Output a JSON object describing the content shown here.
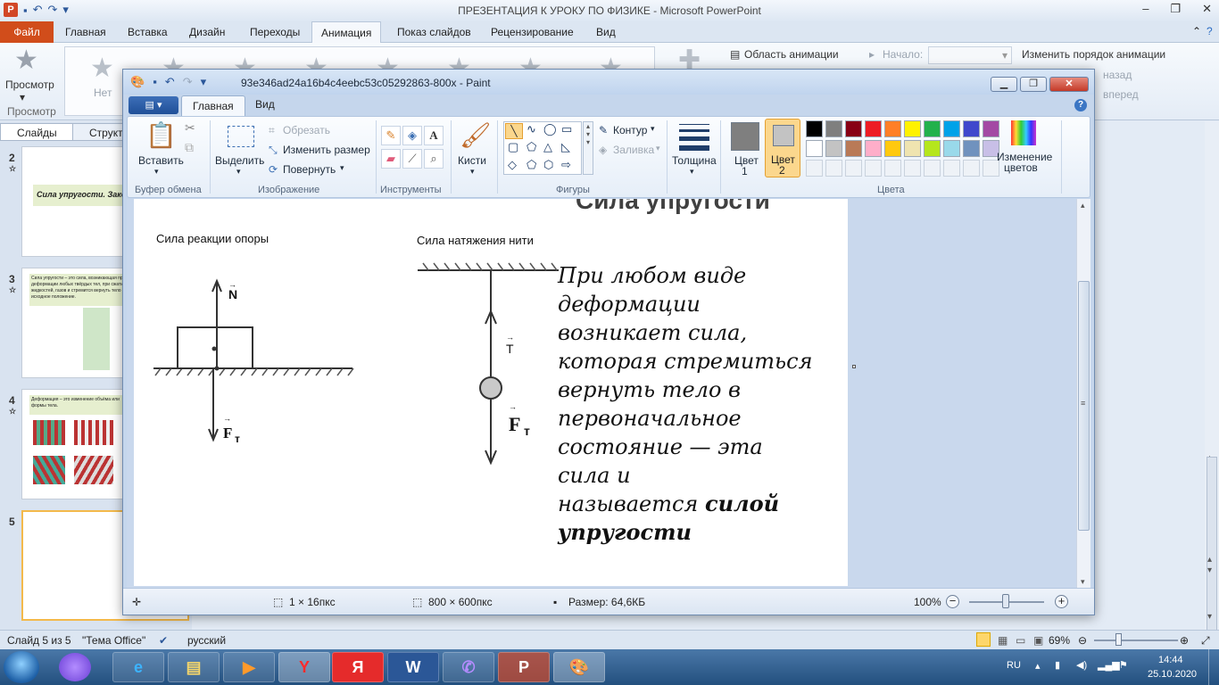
{
  "powerpoint": {
    "title": "ПРЕЗЕНТАЦИЯ К УРОКУ ПО ФИЗИКЕ  -  Microsoft PowerPoint",
    "tabs": [
      "Файл",
      "Главная",
      "Вставка",
      "Дизайн",
      "Переходы",
      "Анимация",
      "Показ слайдов",
      "Рецензирование",
      "Вид"
    ],
    "active_tab": "Анимация",
    "ribbon": {
      "preview": "Просмотр",
      "preview_group": "Просмотр",
      "none": "Нет",
      "animation_pane": "Область анимации",
      "start_label": "Начало:",
      "reorder": "Изменить порядок анимации",
      "move_back": "назад",
      "move_forward": "вперед"
    },
    "panel_tabs": [
      "Слайды",
      "Структура"
    ],
    "thumbnails": [
      {
        "num": "2",
        "text": "Сила упругости. Закон"
      },
      {
        "num": "3",
        "text": "Сила упругости – это сила, возникающая при деформации любых твёрдых тел, при сжатии жидкостей, газов и стремится вернуть тело в исходное положение."
      },
      {
        "num": "4",
        "text": "Деформация – это изменение объёма или формы тела."
      },
      {
        "num": "5",
        "text": ""
      }
    ],
    "status": {
      "slide": "Слайд 5 из 5",
      "theme": "\"Тема Office\"",
      "lang": "русский",
      "zoom": "69%"
    }
  },
  "paint": {
    "title": "93e346ad24a16b4c4eebc53c05292863-800x - Paint",
    "tabs": [
      "Главная",
      "Вид"
    ],
    "ribbon": {
      "paste": "Вставить",
      "clipboard_group": "Буфер обмена",
      "select": "Выделить",
      "crop": "Обрезать",
      "resize": "Изменить размер",
      "rotate": "Повернуть",
      "image_group": "Изображение",
      "tools_group": "Инструменты",
      "brushes": "Кисти",
      "outline": "Контур",
      "fill": "Заливка",
      "shapes_group": "Фигуры",
      "size": "Толщина",
      "color1_a": "Цвет",
      "color1_b": "1",
      "color2_a": "Цвет",
      "color2_b": "2",
      "colors_group": "Цвета",
      "edit_colors_a": "Изменение",
      "edit_colors_b": "цветов"
    },
    "palette": [
      "#000000",
      "#7f7f7f",
      "#880015",
      "#ed1c24",
      "#ff7f27",
      "#fff200",
      "#22b14c",
      "#00a2e8",
      "#3f48cc",
      "#a349a4",
      "#ffffff",
      "#c3c3c3",
      "#b97a57",
      "#ffaec9",
      "#ffc90e",
      "#efe4b0",
      "#b5e61d",
      "#99d9ea",
      "#7092be",
      "#c8bfe7"
    ],
    "color1": "#7f7f7f",
    "color2": "#c3c3c3",
    "status": {
      "selection": "1 × 16пкс",
      "image_size": "800 × 600пкс",
      "file_size": "Размер: 64,6КБ",
      "zoom": "100%"
    },
    "slide": {
      "title": "Сила упругости",
      "caption_support": "Сила реакции опоры",
      "caption_tension": "Сила натяжения нити",
      "label_n": "N",
      "label_ft": "F",
      "label_ft_sub": "т",
      "label_t": "T",
      "text_lines": [
        "При любом виде",
        "деформации",
        "возникает сила,",
        "которая стремиться",
        "вернуть тело в",
        "первоначальное",
        "состояние — эта",
        "сила и"
      ],
      "text_last": "называется ",
      "text_bold_1": "силой",
      "text_bold_2": "упругости"
    }
  },
  "taskbar": {
    "lang": "RU",
    "time": "14:44",
    "date": "25.10.2020",
    "apps": [
      "Алиса",
      "Internet Explorer",
      "Проводник",
      "Медиаплеер",
      "Яндекс.Браузер",
      "Яндекс",
      "Word",
      "Viber",
      "PowerPoint",
      "Paint"
    ]
  }
}
